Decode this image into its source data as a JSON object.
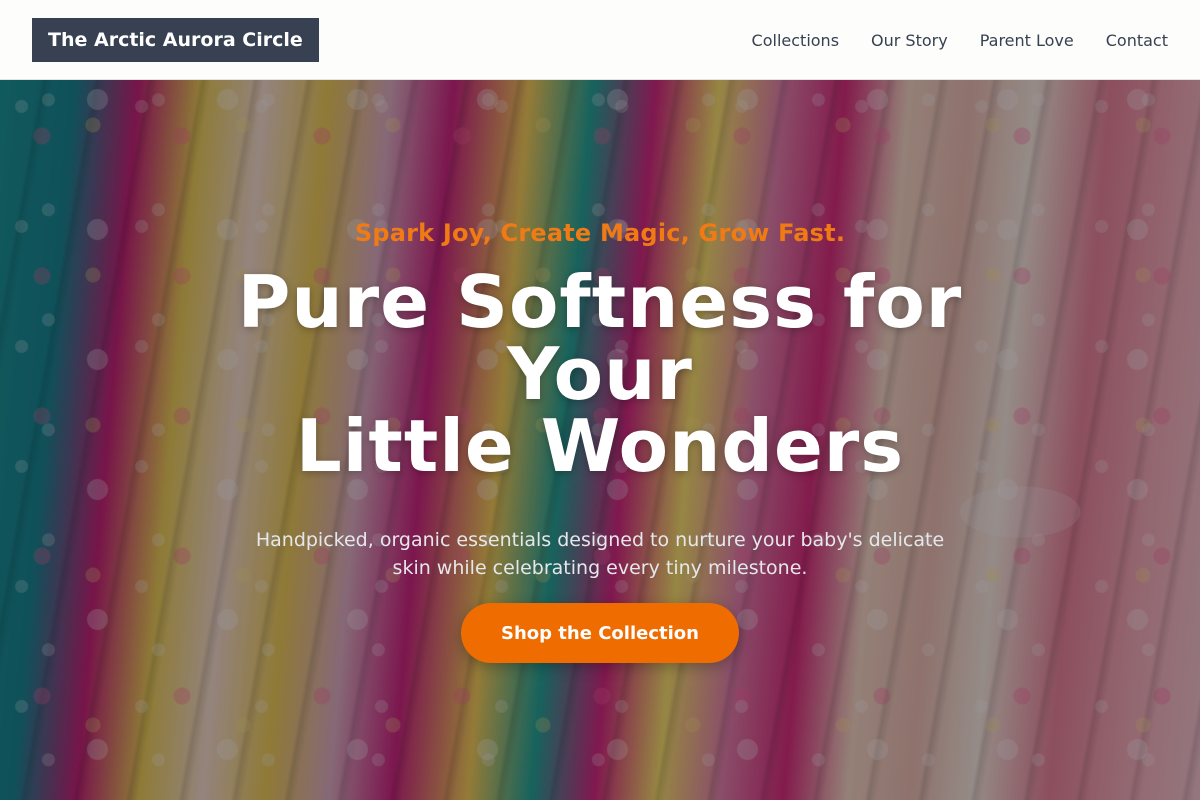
{
  "header": {
    "logo": "The Arctic Aurora Circle",
    "nav": [
      {
        "label": "Collections"
      },
      {
        "label": "Our Story"
      },
      {
        "label": "Parent Love"
      },
      {
        "label": "Contact"
      }
    ]
  },
  "hero": {
    "tagline": "Spark Joy, Create Magic, Grow Fast.",
    "headline_lines": [
      "Pure Softness for",
      "Your",
      "Little Wonders"
    ],
    "subtext": "Handpicked, organic essentials designed to nurture your baby's delicate skin while celebrating every tiny milestone.",
    "cta_label": "Shop the Collection"
  },
  "colors": {
    "header_bg": "#fdfdfc",
    "logo_bg": "#374151",
    "accent": "#ef6c00",
    "tagline": "#f07a14",
    "nav_text": "#374151"
  }
}
